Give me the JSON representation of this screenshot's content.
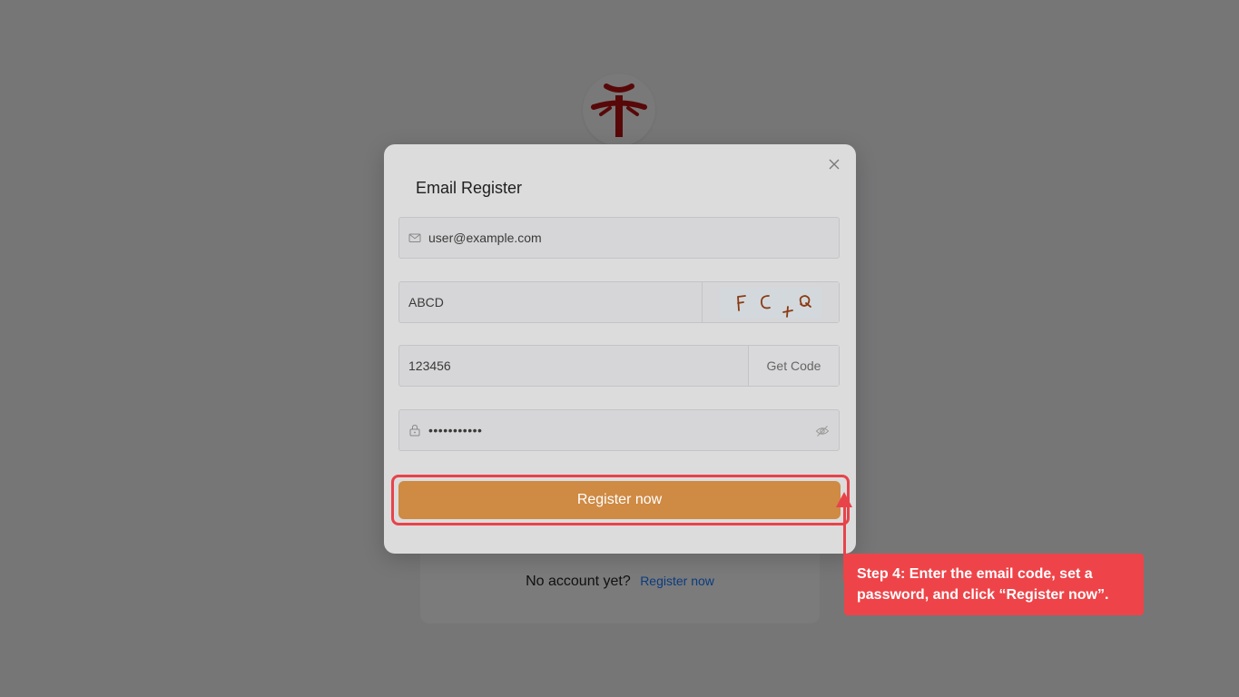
{
  "background": {
    "signup_prompt": "No account yet?",
    "signup_link": "Register now"
  },
  "modal": {
    "title": "Email Register",
    "email_value": "user@example.com",
    "captcha_value": "ABCD",
    "captcha_image_text": "F C +Q",
    "email_code_value": "123456",
    "get_code_label": "Get Code",
    "password_masked": "•••••••••••",
    "submit_label": "Register now"
  },
  "annotation": {
    "text": "Step 4: Enter the email code, set a password, and click “Register now”."
  },
  "colors": {
    "accent": "#cf8a43",
    "annotation": "#ee4449",
    "link": "#1677ff"
  },
  "icons": [
    "logo",
    "close-icon",
    "mail-icon",
    "lock-icon",
    "eye-off-icon"
  ]
}
